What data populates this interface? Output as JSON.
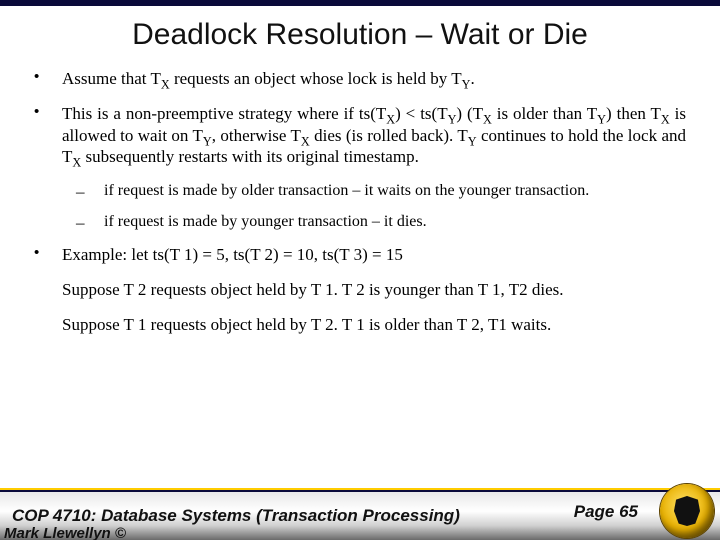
{
  "title": "Deadlock Resolution – Wait or Die",
  "bullets": {
    "b1": "Assume that T",
    "b1_tail": " requests an object whose lock is held by T",
    "b1_end": ".",
    "b2_p1": "This is a non-preemptive strategy where if ts(T",
    "b2_p2": ") < ts(T",
    "b2_p3": ") (T",
    "b2_p4": " is older than T",
    "b2_p5": ") then T",
    "b2_p6": " is allowed to wait on T",
    "b2_p7": ", otherwise T",
    "b2_p8": " dies (is rolled back).  T",
    "b2_p9": " continues to hold the lock and T",
    "b2_p10": " subsequently restarts with its original timestamp.",
    "s1": "if request is made by older transaction – it waits on the younger transaction.",
    "s2": "if request is made by younger transaction – it dies.",
    "ex_intro": "Example:  let ts(T 1) = 5, ts(T 2) = 10, ts(T 3) = 15",
    "ex_line1": "Suppose T 2 requests object held by T 1.  T 2 is younger than T 1, T2 dies.",
    "ex_line2": "Suppose T 1 requests object held by T 2.   T 1 is older than T 2, T1 waits."
  },
  "subs": {
    "X": "X",
    "Y": "Y"
  },
  "footer": {
    "course": "COP 4710: Database Systems  (Transaction Processing)",
    "page": "Page 65",
    "author": "Mark Llewellyn ©"
  }
}
